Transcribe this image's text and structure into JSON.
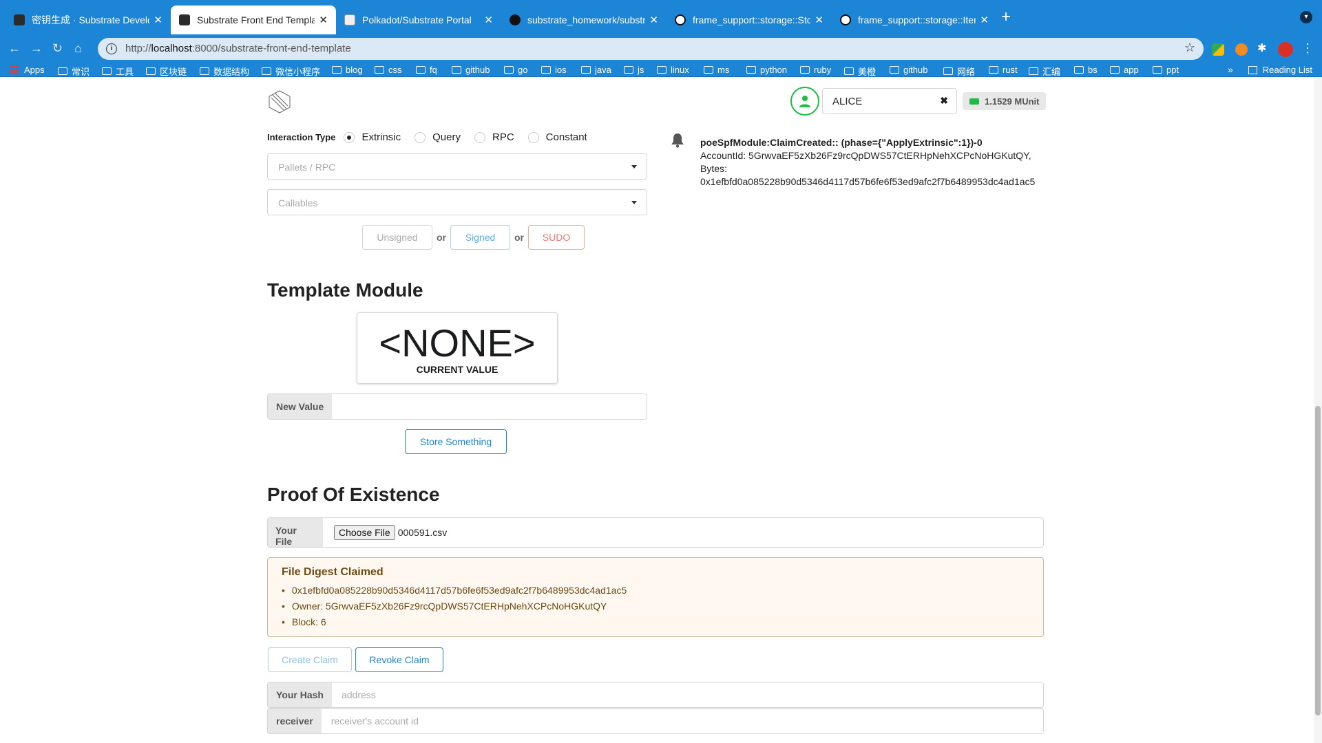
{
  "browser": {
    "tabs": [
      {
        "title": "密钥生成 · Substrate Developer",
        "active": false
      },
      {
        "title": "Substrate Front End Template",
        "active": true
      },
      {
        "title": "Polkadot/Substrate Portal",
        "active": false
      },
      {
        "title": "substrate_homework/substrate",
        "active": false
      },
      {
        "title": "frame_support::storage::Storag",
        "active": false
      },
      {
        "title": "frame_support::storage::Iterab",
        "active": false
      }
    ],
    "url_prefix": "http://",
    "url_host": "localhost",
    "url_rest": ":8000/substrate-front-end-template",
    "bookmarks": [
      "Apps",
      "常识",
      "工具",
      "区块链",
      "数据结构",
      "微信小程序",
      "blog",
      "css",
      "fq",
      "github",
      "go",
      "ios",
      "java",
      "js",
      "linux",
      "ms",
      "python",
      "ruby",
      "美橙",
      "github",
      "网络",
      "rust",
      "汇编",
      "bs",
      "app",
      "ppt"
    ],
    "reading_list": "Reading List",
    "more": "»"
  },
  "account": {
    "name": "ALICE",
    "balance": "1.1529 MUnit"
  },
  "interaction": {
    "label": "Interaction Type",
    "options": [
      "Extrinsic",
      "Query",
      "RPC",
      "Constant"
    ],
    "selected": "Extrinsic",
    "pallets_placeholder": "Pallets / RPC",
    "callables_placeholder": "Callables",
    "unsigned": "Unsigned",
    "signed": "Signed",
    "sudo": "SUDO",
    "or": "or"
  },
  "event": {
    "title": "poeSpfModule:ClaimCreated:: (phase={\"ApplyExtrinsic\":1})-0",
    "line1": "AccountId: 5GrwvaEF5zXb26Fz9rcQpDWS57CtERHpNehXCPcNoHGKutQY,",
    "line2": "Bytes:",
    "line3": "0x1efbfd0a085228b90d5346d4117d57b6fe6f53ed9afc2f7b6489953dc4ad1ac5"
  },
  "template_module": {
    "title": "Template Module",
    "value": "<NONE>",
    "value_label": "CURRENT VALUE",
    "new_value_label": "New Value",
    "store_button": "Store Something"
  },
  "poe": {
    "title": "Proof Of Existence",
    "file_label": "Your File",
    "choose_file": "Choose File",
    "file_name": "000591.csv",
    "claim_header": "File Digest Claimed",
    "digest": "0x1efbfd0a085228b90d5346d4117d57b6fe6f53ed9afc2f7b6489953dc4ad1ac5",
    "owner": "Owner: 5GrwvaEF5zXb26Fz9rcQpDWS57CtERHpNehXCPcNoHGKutQY",
    "block": "Block: 6",
    "create_claim": "Create Claim",
    "revoke_claim": "Revoke Claim",
    "hash_label": "Your Hash",
    "hash_placeholder": "address",
    "receiver_label": "receiver",
    "receiver_placeholder": "receiver's account id"
  }
}
